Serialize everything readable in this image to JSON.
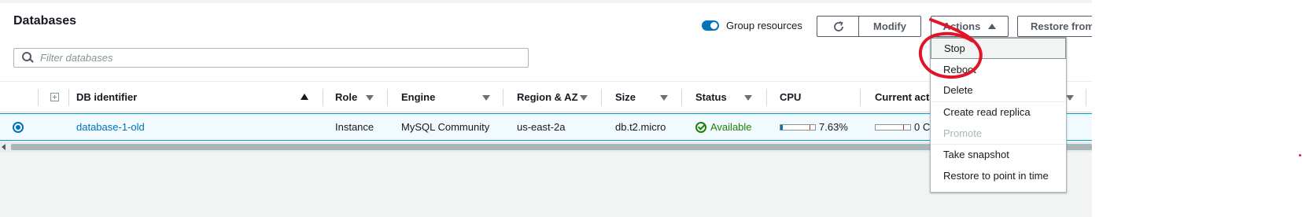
{
  "header": {
    "title": "Databases",
    "group_toggle": {
      "label": "Group resources",
      "on": true
    },
    "buttons": {
      "refresh_icon": "refresh-icon",
      "modify": "Modify",
      "actions": "Actions",
      "restore": "Restore from"
    }
  },
  "search": {
    "placeholder": "Filter databases",
    "icon": "search-icon"
  },
  "table": {
    "columns": [
      {
        "label": "DB identifier",
        "sort": "ascending"
      },
      {
        "label": "Role"
      },
      {
        "label": "Engine"
      },
      {
        "label": "Region & AZ"
      },
      {
        "label": "Size"
      },
      {
        "label": "Status"
      },
      {
        "label": "CPU"
      },
      {
        "label": "Current act"
      }
    ],
    "rows": [
      {
        "selected": true,
        "identifier": "database-1-old",
        "role": "Instance",
        "engine": "MySQL Community",
        "region": "us-east-2a",
        "size": "db.t2.micro",
        "status": "Available",
        "cpu": "7.63%",
        "cpu_fraction": 0.0763,
        "current_activity": "0 C"
      }
    ]
  },
  "actions_menu": {
    "items": [
      {
        "label": "Stop",
        "state": "hover"
      },
      {
        "label": "Reboot"
      },
      {
        "label": "Delete"
      },
      {
        "label": "Create read replica"
      },
      {
        "label": "Promote",
        "state": "disabled"
      },
      {
        "label": "Take snapshot"
      },
      {
        "label": "Restore to point in time"
      }
    ]
  },
  "colors": {
    "link": "#0073bb",
    "available": "#1d8102",
    "annotation": "#e1152a",
    "toggle_on": "#0073bb"
  }
}
